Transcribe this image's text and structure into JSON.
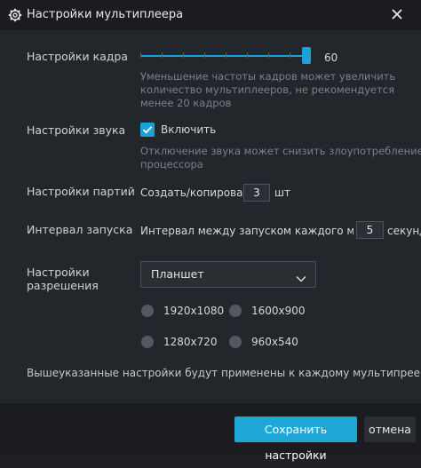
{
  "window": {
    "title": "Настройки мультиплеера",
    "title_icon": "gear-icon",
    "close_icon": "close-icon"
  },
  "frame_rate": {
    "label": "Настройки кадра",
    "value": 60,
    "value_text": "60",
    "hint_lines": [
      "Уменьшение частоты кадров может увеличить",
      "количество мультиплееров, не рекомендуется",
      "менее 20 кадров"
    ]
  },
  "sound": {
    "label": "Настройки звука",
    "checkbox_label": "Включить",
    "checked": true,
    "hint_lines": [
      "Отключение звука может снизить злоупотребление",
      "процессора"
    ]
  },
  "batch": {
    "label": "Настройки партий",
    "prefix": "Создать/копировать",
    "value": "3",
    "suffix": "шт"
  },
  "launch_interval": {
    "label": "Интервал запуска",
    "prefix": "Интервал между запуском каждого мульт",
    "value": "5",
    "suffix": "секунд"
  },
  "resolution": {
    "label_lines": [
      "Настройки",
      "разрешения"
    ],
    "selected": "Планшет",
    "options": [
      "1920x1080",
      "1600x900",
      "1280x720",
      "960x540"
    ]
  },
  "footer_note": "Вышеуказанные настройки будут применены к каждому мультипрееру",
  "buttons": {
    "save": "Сохранить настройки",
    "cancel": "отмена"
  },
  "colors": {
    "accent": "#1fa7d8",
    "background": "#23262a",
    "titlebar": "#1a1c1f"
  }
}
